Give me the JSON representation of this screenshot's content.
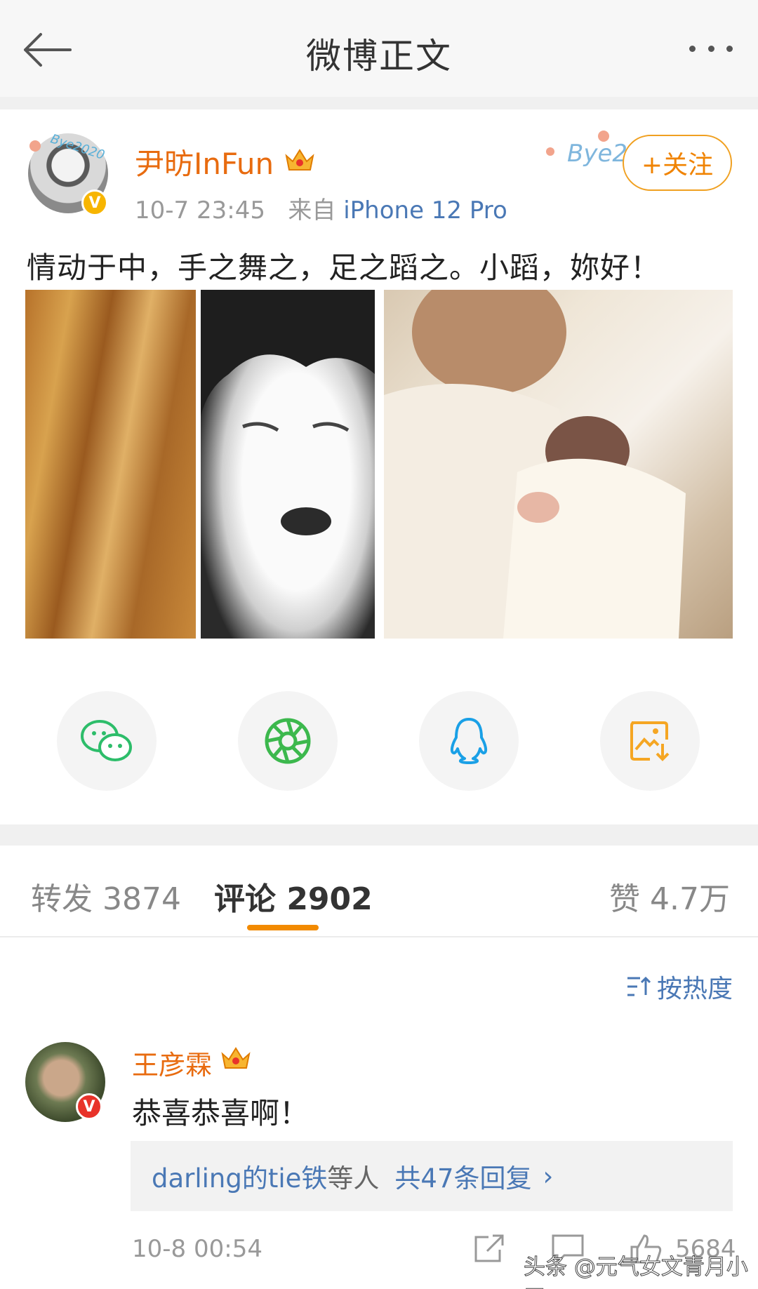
{
  "header": {
    "title": "微博正文",
    "back_icon": "back-arrow-icon",
    "more_icon": "more-dots-icon"
  },
  "post": {
    "author": "尹昉InFun",
    "time": "10-7 23:45",
    "source_prefix": "来自",
    "source": "iPhone 12 Pro",
    "follow_label": "+关注",
    "text": "情动于中，手之舞之，足之蹈之。小蹈，妳好！",
    "avatar_decoration_text": "Bye2020",
    "right_decoration_text": "Bye2",
    "images": [
      "ultrasound-photo",
      "sleeping-face-photo",
      "father-holding-newborn-photo"
    ]
  },
  "share_buttons": [
    {
      "name": "wechat",
      "icon": "wechat-icon",
      "color": "#2dbd6a"
    },
    {
      "name": "moments",
      "icon": "moments-icon",
      "color": "#3cb84d"
    },
    {
      "name": "qq",
      "icon": "qq-icon",
      "color": "#1aa0e6"
    },
    {
      "name": "save-image",
      "icon": "save-image-icon",
      "color": "#f5a623"
    }
  ],
  "tabs": {
    "repost": "转发 3874",
    "comments": "评论 2902",
    "likes": "赞 4.7万"
  },
  "sort_label": "按热度",
  "comment": {
    "author": "王彦霖",
    "text": "恭喜恭喜啊！",
    "reply_users": "darling的tie铁",
    "reply_mid": "等人",
    "reply_count": "共47条回复",
    "reply_arrow": "›",
    "time": "10-8 00:54",
    "like_count": "5684"
  },
  "watermark": "头条 @元气女文青月小牙",
  "colors": {
    "accent_orange": "#f28a00",
    "link_blue": "#4a78b5",
    "name_orange": "#e86b0f"
  }
}
